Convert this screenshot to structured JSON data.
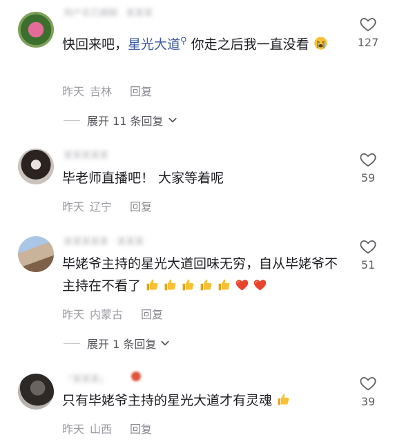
{
  "comments": [
    {
      "username": "用户名已模糊 · 某某某",
      "text_prefix": "快回来吧，",
      "link": "星光大道",
      "text_suffix": " 你走之后我一直没看",
      "emoji": "crying-emoji",
      "time": "昨天",
      "location": "吉林",
      "reply": "回复",
      "likes": "127",
      "expand": "展开 11 条回复"
    },
    {
      "username": "某某某某某",
      "text": "毕老师直播吧！ 大家等着呢",
      "time": "昨天",
      "location": "辽宁",
      "reply": "回复",
      "likes": "59"
    },
    {
      "username": "某某某某某 · 某某某",
      "text": "毕姥爷主持的星光大道回味无穷，自从毕姥爷不主持在不看了",
      "emojis": [
        "thumbs-up",
        "thumbs-up",
        "thumbs-up",
        "thumbs-up",
        "thumbs-up",
        "heart",
        "heart"
      ],
      "time": "昨天",
      "location": "内蒙古",
      "reply": "回复",
      "likes": "51",
      "expand": "展开 1 条回复"
    },
    {
      "username": "「某某某」",
      "text": "只有毕姥爷主持的星光大道才有灵魂",
      "emoji": "thumbs-up",
      "time": "昨天",
      "location": "山西",
      "reply": "回复",
      "likes": "39"
    }
  ],
  "colors": {
    "link": "#3b5aa0",
    "meta": "#9a9aa1",
    "text": "#1c1c22",
    "like_icon": "#5f5f66"
  }
}
